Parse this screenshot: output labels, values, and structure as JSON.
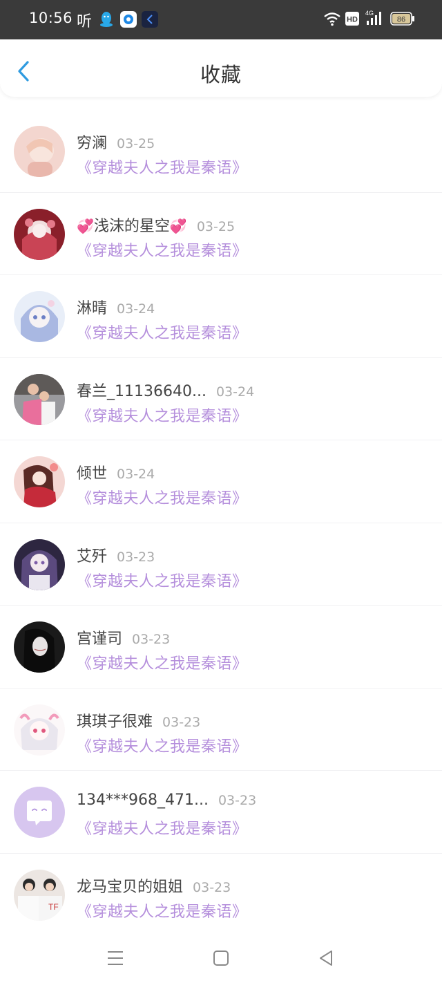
{
  "status_bar": {
    "time": "10:56",
    "ting_label": "听",
    "battery": "86",
    "network": "4G",
    "hd": "HD",
    "icons": [
      "qq-icon",
      "browser-icon",
      "app-icon",
      "wifi-icon",
      "hd-icon",
      "signal-icon",
      "battery-icon"
    ]
  },
  "header": {
    "title": "收藏",
    "back_icon": "chevron-left-icon"
  },
  "favorites": [
    {
      "name": "穷澜",
      "date": "03-25",
      "book": "《穿越夫人之我是秦语》"
    },
    {
      "name": "浅沫的星空",
      "date": "03-25",
      "book": "《穿越夫人之我是秦语》",
      "heart": "💞"
    },
    {
      "name": "淋晴",
      "date": "03-24",
      "book": "《穿越夫人之我是秦语》"
    },
    {
      "name": "春兰_11136640...",
      "date": "03-24",
      "book": "《穿越夫人之我是秦语》"
    },
    {
      "name": "倾世",
      "date": "03-24",
      "book": "《穿越夫人之我是秦语》"
    },
    {
      "name": "艾歼",
      "date": "03-23",
      "book": "《穿越夫人之我是秦语》"
    },
    {
      "name": "宫谨司",
      "date": "03-23",
      "book": "《穿越夫人之我是秦语》"
    },
    {
      "name": "琪琪子很难",
      "date": "03-23",
      "book": "《穿越夫人之我是秦语》"
    },
    {
      "name": "134***968_471...",
      "date": "03-23",
      "book": "《穿越夫人之我是秦语》"
    },
    {
      "name": "龙马宝贝的姐姐",
      "date": "03-23",
      "book": "《穿越夫人之我是秦语》"
    }
  ],
  "colors": {
    "accent": "#2f9be0",
    "book_title": "#b58fdc",
    "status_bar_bg": "#3a3a3a"
  },
  "nav": {
    "icons": [
      "menu-icon",
      "home-icon",
      "back-triangle-icon"
    ]
  }
}
